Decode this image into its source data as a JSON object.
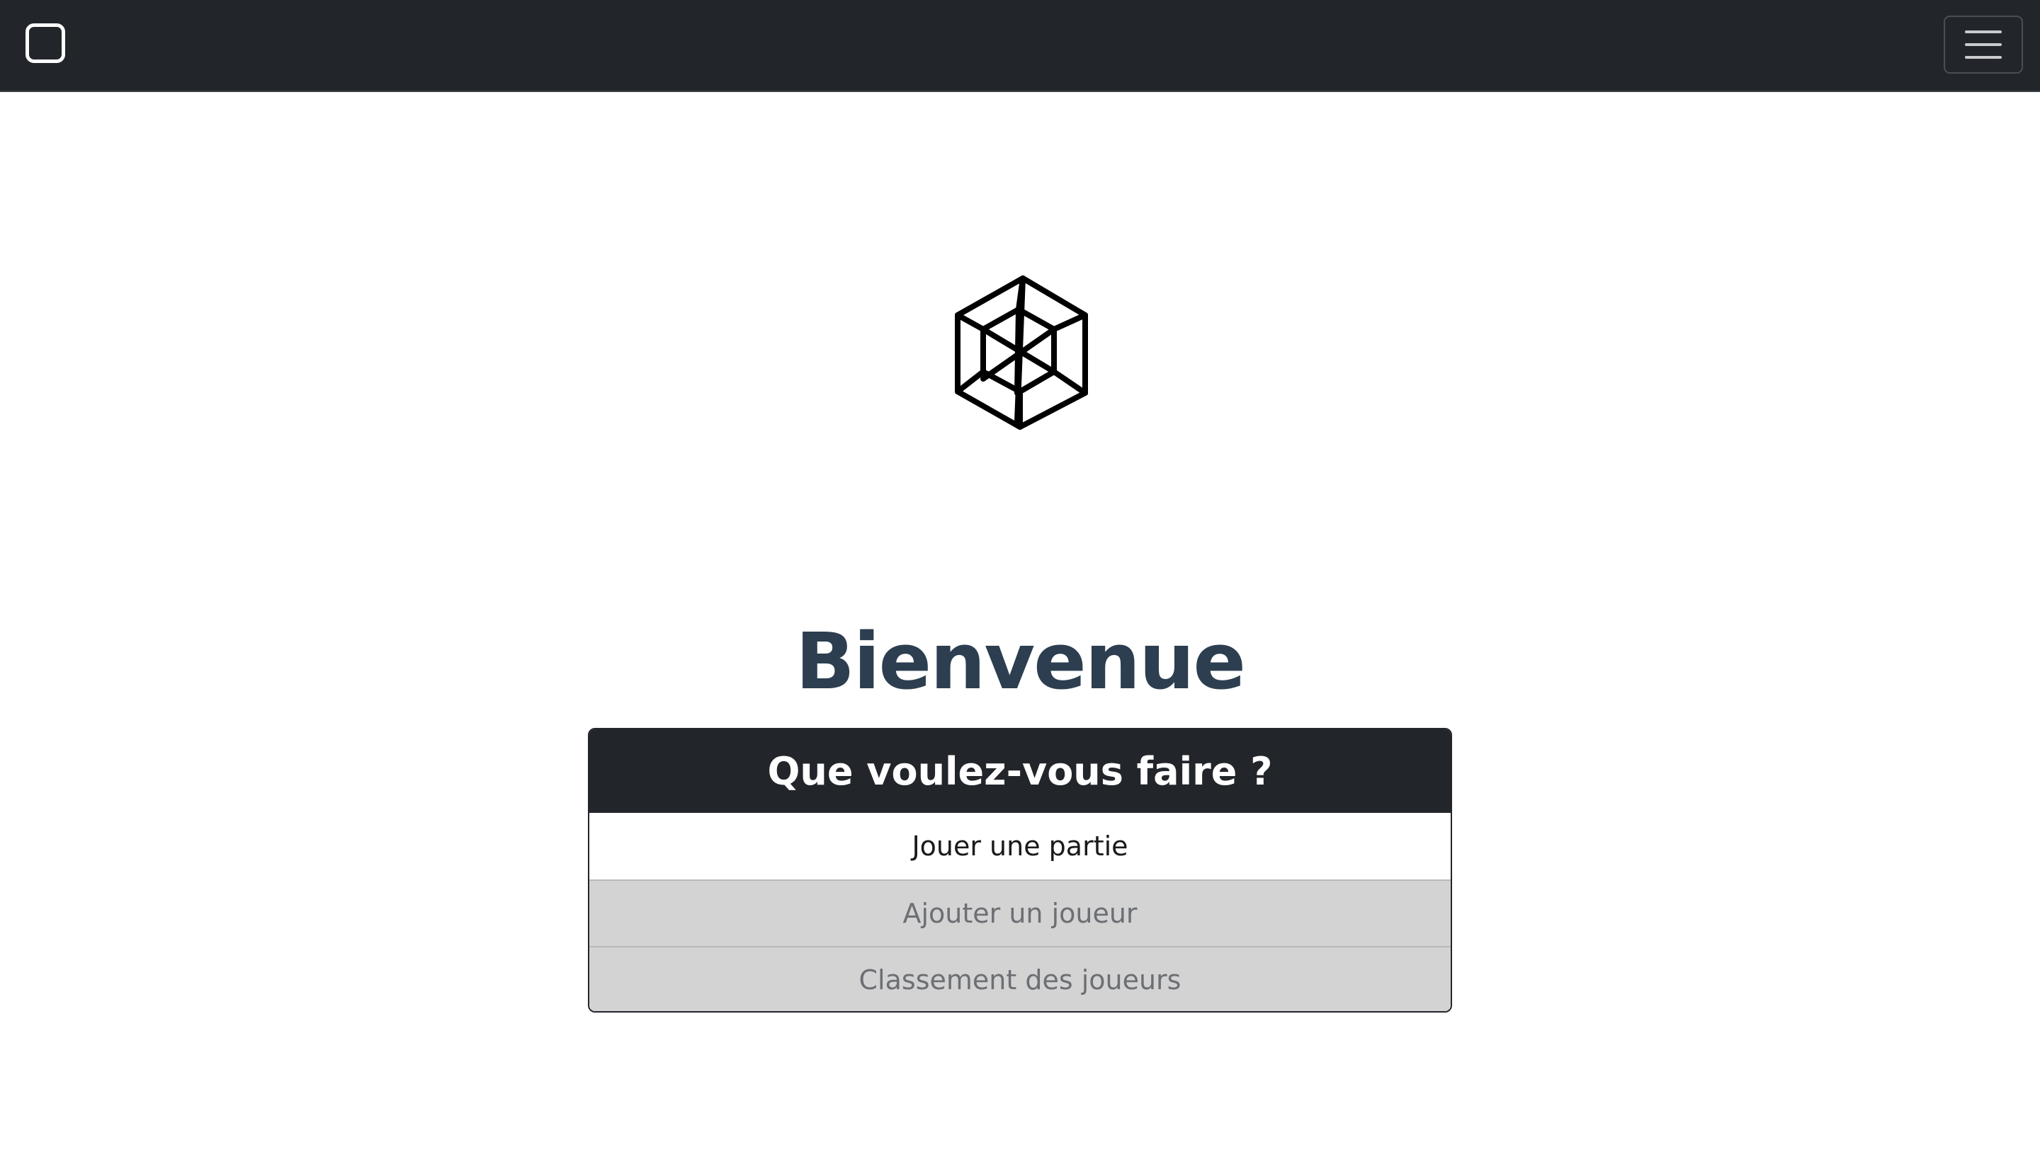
{
  "navbar": {
    "brand_icon": "square-outline-icon",
    "toggler_icon": "hamburger-menu-icon",
    "background": "#22262b"
  },
  "hero": {
    "logo_icon": "hypercube-icon",
    "title": "Bienvenue",
    "title_color": "#2c3e50"
  },
  "menu": {
    "header": "Que voulez-vous faire ?",
    "items": [
      {
        "label": "Jouer une partie",
        "state": "active"
      },
      {
        "label": "Ajouter un joueur",
        "state": "muted"
      },
      {
        "label": "Classement des joueurs",
        "state": "muted"
      }
    ]
  }
}
